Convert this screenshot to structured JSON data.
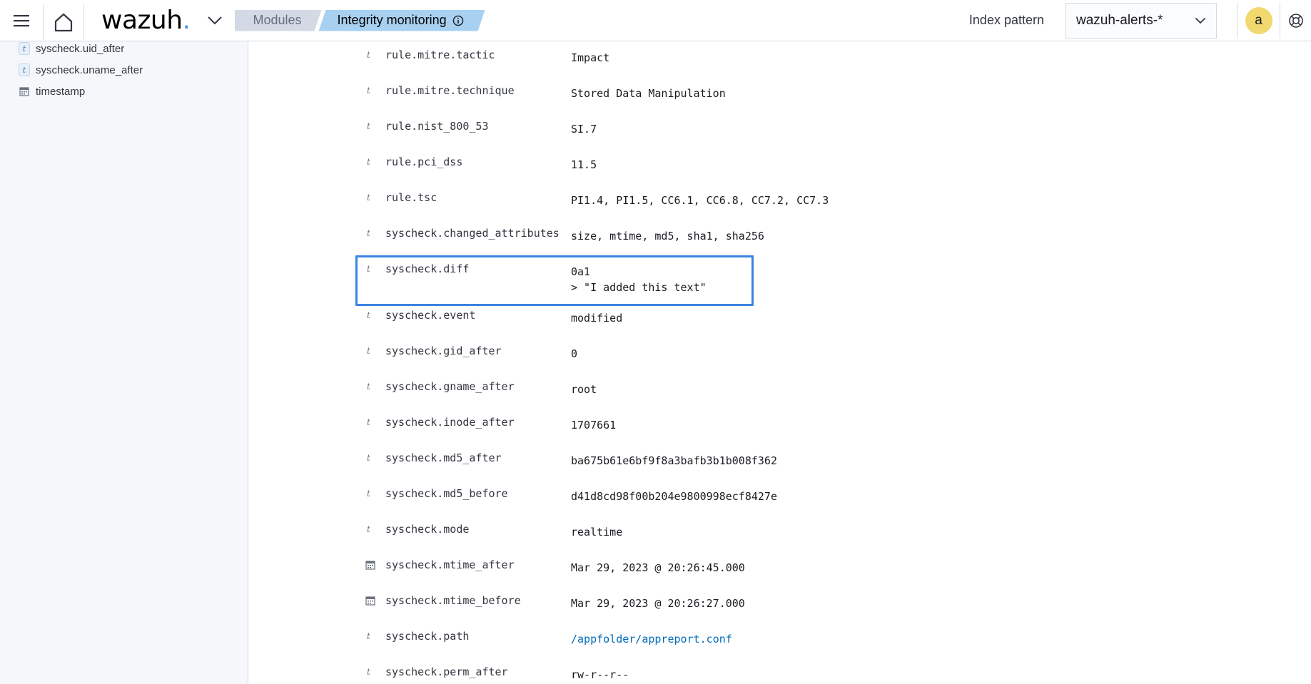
{
  "header": {
    "logo_text": "wazuh",
    "logo_dot": ".",
    "breadcrumb_modules": "Modules",
    "breadcrumb_current": "Integrity monitoring",
    "index_pattern_label": "Index pattern",
    "index_pattern_value": "wazuh-alerts-*",
    "user_initial": "a"
  },
  "colors": {
    "accent": "#3595f9",
    "highlight_border": "#3a85e0",
    "link": "#006bb8",
    "avatar_bg": "#f1d86f"
  },
  "sidebar": {
    "fields": [
      {
        "type": "t",
        "name": "syscheck.uid_after"
      },
      {
        "type": "t",
        "name": "syscheck.uname_after"
      },
      {
        "type": "date",
        "name": "timestamp"
      }
    ]
  },
  "document": {
    "rows": [
      {
        "type": "t",
        "field": "rule.mitre.tactic",
        "value": "Impact"
      },
      {
        "type": "t",
        "field": "rule.mitre.technique",
        "value": "Stored Data Manipulation"
      },
      {
        "type": "t",
        "field": "rule.nist_800_53",
        "value": "SI.7"
      },
      {
        "type": "t",
        "field": "rule.pci_dss",
        "value": "11.5"
      },
      {
        "type": "t",
        "field": "rule.tsc",
        "value": "PI1.4, PI1.5, CC6.1, CC6.8, CC7.2, CC7.3"
      },
      {
        "type": "t",
        "field": "syscheck.changed_attributes",
        "value": "size, mtime, md5, sha1, sha256"
      },
      {
        "type": "t",
        "field": "syscheck.diff",
        "value": "0a1\n> \"I added this text\""
      },
      {
        "type": "t",
        "field": "syscheck.event",
        "value": "modified"
      },
      {
        "type": "t",
        "field": "syscheck.gid_after",
        "value": "0"
      },
      {
        "type": "t",
        "field": "syscheck.gname_after",
        "value": "root"
      },
      {
        "type": "t",
        "field": "syscheck.inode_after",
        "value": "1707661"
      },
      {
        "type": "t",
        "field": "syscheck.md5_after",
        "value": "ba675b61e6bf9f8a3bafb3b1b008f362"
      },
      {
        "type": "t",
        "field": "syscheck.md5_before",
        "value": "d41d8cd98f00b204e9800998ecf8427e"
      },
      {
        "type": "t",
        "field": "syscheck.mode",
        "value": "realtime"
      },
      {
        "type": "date",
        "field": "syscheck.mtime_after",
        "value": "Mar 29, 2023 @ 20:26:45.000"
      },
      {
        "type": "date",
        "field": "syscheck.mtime_before",
        "value": "Mar 29, 2023 @ 20:26:27.000"
      },
      {
        "type": "t",
        "field": "syscheck.path",
        "value": "/appfolder/appreport.conf",
        "link": true
      },
      {
        "type": "t",
        "field": "syscheck.perm_after",
        "value": "rw-r--r--"
      }
    ]
  }
}
